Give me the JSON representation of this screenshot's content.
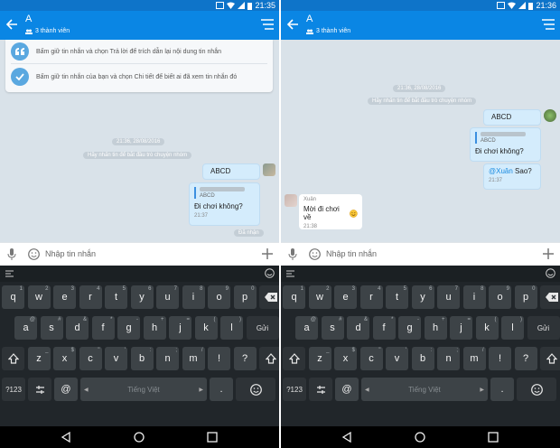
{
  "left": {
    "status": {
      "time": "21:35"
    },
    "header": {
      "title": "A",
      "members": "3 thành viên"
    },
    "tips": [
      {
        "text": "Bấm giữ tin nhắn và chọn Trả lời để trích dẫn lại nội dung tin nhắn"
      },
      {
        "text": "Bấm giữ tin nhắn của bạn và chọn Chi tiết để biết ai đã xem tin nhắn đó"
      }
    ],
    "timestamp": "21:36, 28/08/2016",
    "system_note": "Hãy nhấn tin để bắt đầu trò chuyện nhóm",
    "msg1": "ABCD",
    "quote": {
      "label": "ABCD",
      "text": "Đi chơi không?",
      "time": "21:37"
    },
    "received": "Đã nhận",
    "input_placeholder": "Nhập tin nhắn"
  },
  "right": {
    "status": {
      "time": "21:36"
    },
    "header": {
      "title": "A",
      "members": "3 thành viên"
    },
    "timestamp": "21:36, 28/08/2016",
    "system_note": "Hãy nhấn tin để bắt đầu trò chuyện nhóm",
    "msg1": "ABCD",
    "quote": {
      "label": "ABCD",
      "text": "Đi chơi không?"
    },
    "mention": {
      "name": "@Xuân",
      "text": " Sao?",
      "time": "21:37"
    },
    "incoming": {
      "sender": "Xuân",
      "text": "Mời đi chơi về",
      "time": "21:38"
    },
    "input_placeholder": "Nhập tin nhắn"
  },
  "keyboard": {
    "row1": [
      {
        "k": "q",
        "h": "1"
      },
      {
        "k": "w",
        "h": "2"
      },
      {
        "k": "e",
        "h": "3"
      },
      {
        "k": "r",
        "h": "4"
      },
      {
        "k": "t",
        "h": "5"
      },
      {
        "k": "y",
        "h": "6"
      },
      {
        "k": "u",
        "h": "7"
      },
      {
        "k": "i",
        "h": "8"
      },
      {
        "k": "o",
        "h": "9"
      },
      {
        "k": "p",
        "h": "0"
      }
    ],
    "row2": [
      {
        "k": "a",
        "h": "@"
      },
      {
        "k": "s",
        "h": "#"
      },
      {
        "k": "d",
        "h": "&"
      },
      {
        "k": "f",
        "h": "*"
      },
      {
        "k": "g",
        "h": "-"
      },
      {
        "k": "h",
        "h": "+"
      },
      {
        "k": "j",
        "h": "="
      },
      {
        "k": "k",
        "h": "("
      },
      {
        "k": "l",
        "h": ")"
      }
    ],
    "row3": [
      {
        "k": "z",
        "h": "_"
      },
      {
        "k": "x",
        "h": "$"
      },
      {
        "k": "c",
        "h": "\""
      },
      {
        "k": "v",
        "h": "'"
      },
      {
        "k": "b",
        "h": ":"
      },
      {
        "k": "n",
        "h": ";"
      },
      {
        "k": "m",
        "h": "/"
      },
      {
        "k": "!",
        "h": ""
      },
      {
        "k": "?",
        "h": ""
      }
    ],
    "enter_label": "Gửi",
    "symbols_label": "?123",
    "at_label": "@",
    "space_label": "Tiếng Việt",
    "dot_label": "."
  }
}
